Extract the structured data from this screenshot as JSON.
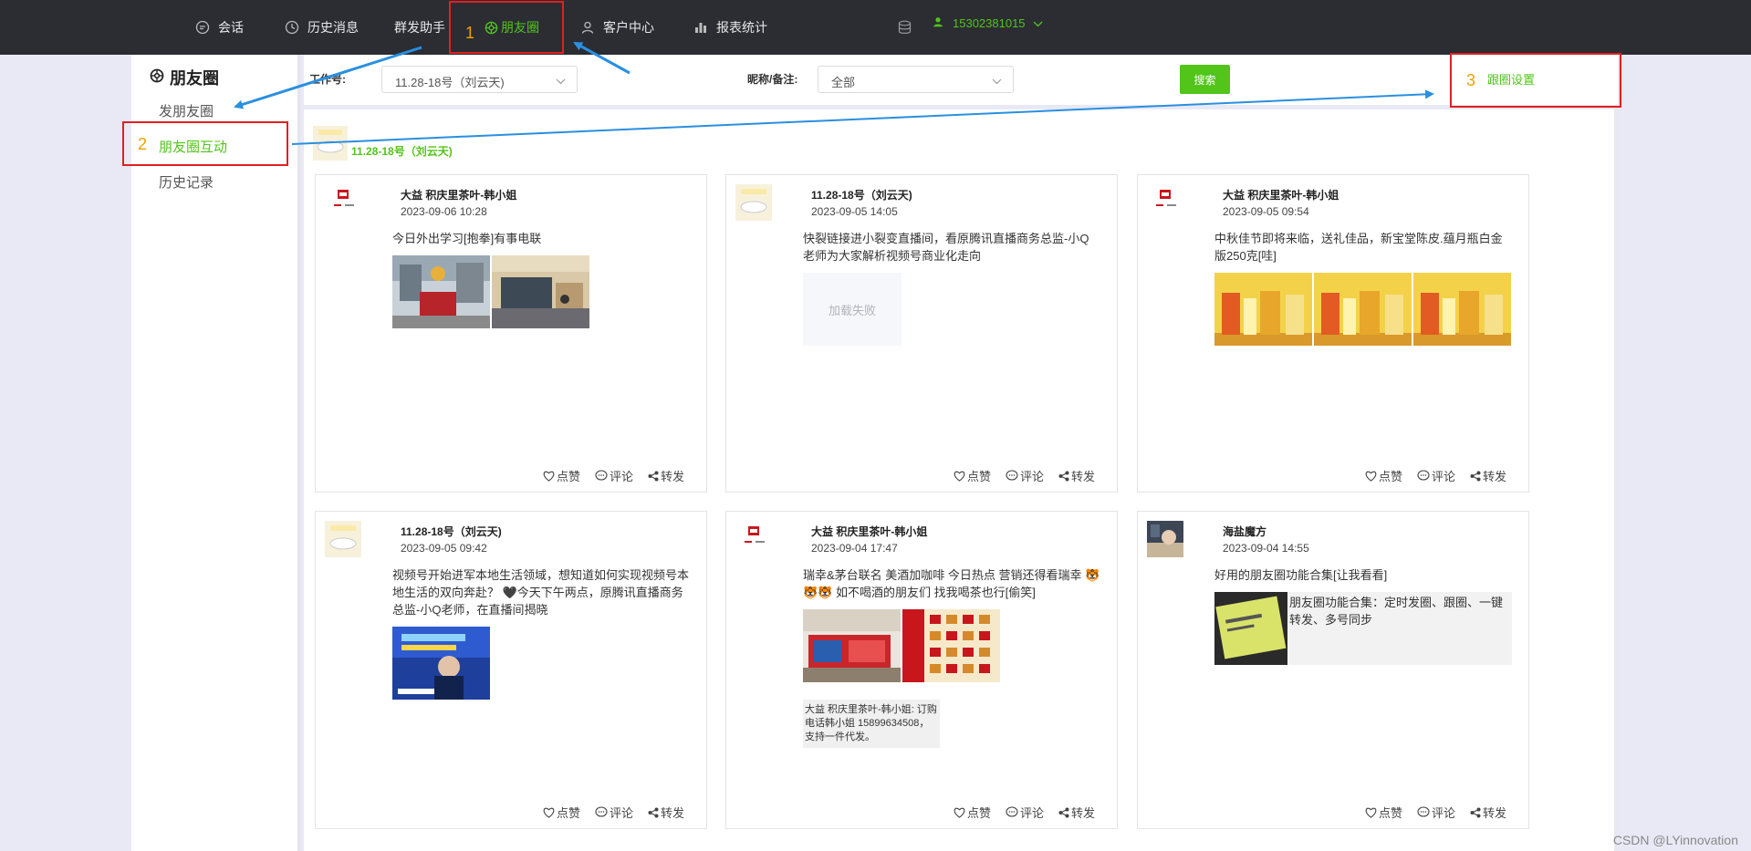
{
  "nav": {
    "items": [
      {
        "label": "会话",
        "icon": "chat-icon"
      },
      {
        "label": "历史消息",
        "icon": "clock-icon"
      },
      {
        "label": "群发助手",
        "icon": ""
      },
      {
        "label": "朋友圈",
        "icon": "moments-icon",
        "active": true
      },
      {
        "label": "客户中心",
        "icon": "user-icon"
      },
      {
        "label": "报表统计",
        "icon": "bar-chart-icon"
      }
    ],
    "user_phone": "15302381015"
  },
  "sidebar": {
    "title": "朋友圈",
    "items": [
      {
        "label": "发朋友圈"
      },
      {
        "label": "朋友圈互动",
        "active": true
      },
      {
        "label": "历史记录"
      }
    ]
  },
  "filters": {
    "account_label": "工作号:",
    "account_value": "11.28-18号（刘云天)",
    "nickname_label": "昵称/备注:",
    "nickname_value": "全部",
    "search_label": "搜索",
    "settings_label": "跟圈设置"
  },
  "account_header": "11.28-18号（刘云天)",
  "posts": [
    {
      "name": "大益 积庆里茶叶-韩小姐",
      "time": "2023-09-06 10:28",
      "text": "今日外出学习[抱拳]有事电联"
    },
    {
      "name": "11.28-18号（刘云天)",
      "time": "2023-09-05 14:05",
      "text": "快裂链接进小裂变直播间，看原腾讯直播商务总监-小Q老师为大家解析视频号商业化走向",
      "fail_text": "加载失败"
    },
    {
      "name": "大益 积庆里茶叶-韩小姐",
      "time": "2023-09-05 09:54",
      "text": "中秋佳节即将来临，送礼佳品，新宝堂陈皮.蕴月瓶白金版250克[哇]"
    },
    {
      "name": "11.28-18号（刘云天)",
      "time": "2023-09-05 09:42",
      "text": "视频号开始进军本地生活领域，想知道如何实现视频号本地生活的双向奔赴？ 🖤今天下午两点，原腾讯直播商务总监-小Q老师，在直播间揭晓"
    },
    {
      "name": "大益 积庆里茶叶-韩小姐",
      "time": "2023-09-04 17:47",
      "text": "瑞幸&茅台联名 美酒加咖啡 今日热点 营销还得看瑞幸 🐯🐯🐯 如不喝酒的朋友们 找我喝茶也行[偷笑]",
      "comment": "大益 积庆里茶叶-韩小姐: 订购电话韩小姐 15899634508，支持一件代发。"
    },
    {
      "name": "海盐魔方",
      "time": "2023-09-04 14:55",
      "text": "好用的朋友圈功能合集[让我看看]",
      "link_text": "朋友圈功能合集：定时发圈、跟圈、一键转发、多号同步"
    }
  ],
  "actions": {
    "like": "点赞",
    "comment": "评论",
    "share": "转发"
  },
  "annotations": {
    "n1": "1",
    "n2": "2",
    "n3": "3"
  },
  "watermark": "CSDN @LYinnovation",
  "colors": {
    "accent": "#52c41a",
    "nav_bg": "#2b2d33",
    "annotation_red": "#e02020",
    "arrow_blue": "#2a8fe0",
    "number_orange": "#f0a000"
  }
}
